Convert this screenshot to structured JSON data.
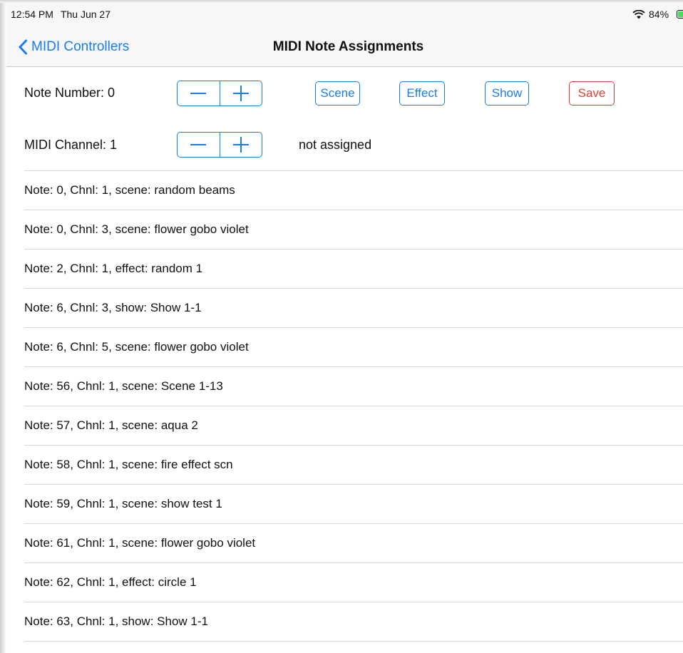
{
  "status_bar": {
    "time": "12:54 PM",
    "day": "Thu Jun 27",
    "battery_percent": "84%",
    "battery_level": 0.84
  },
  "nav": {
    "back_label": "MIDI Controllers",
    "title": "MIDI Note Assignments"
  },
  "controls": {
    "note_number_label": "Note Number: 0",
    "midi_channel_label": "MIDI Channel: 1",
    "scene_label": "Scene",
    "effect_label": "Effect",
    "show_label": "Show",
    "save_label": "Save",
    "assignment_status": "not assigned"
  },
  "colors": {
    "accent": "#1a7cf2",
    "destructive": "#e53b30",
    "battery": "#4cd964"
  },
  "assignments": [
    "Note: 0, Chnl: 1, scene: random beams",
    "Note: 0, Chnl: 3, scene: flower gobo violet",
    "Note: 2, Chnl: 1, effect: random 1",
    "Note: 6, Chnl: 3, show: Show 1-1",
    "Note: 6, Chnl: 5, scene: flower gobo violet",
    "Note: 56, Chnl: 1, scene: Scene 1-13",
    "Note: 57, Chnl: 1, scene: aqua 2",
    "Note: 58, Chnl: 1, scene: fire effect scn",
    "Note: 59, Chnl: 1, scene: show test 1",
    "Note: 61, Chnl: 1, scene: flower gobo violet",
    "Note: 62, Chnl: 1, effect: circle 1",
    "Note: 63, Chnl: 1, show: Show 1-1"
  ]
}
